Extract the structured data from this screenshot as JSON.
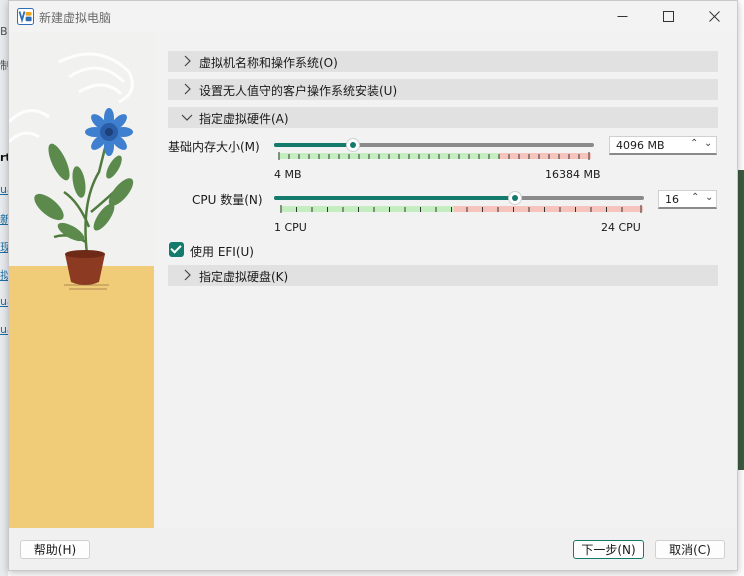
{
  "window": {
    "title": "新建虚拟电脑"
  },
  "titlebar": {
    "minimize_icon": "minimize-icon",
    "maximize_icon": "maximize-icon",
    "close_icon": "close-icon"
  },
  "sections": [
    {
      "label": "虚拟机名称和操作系统(O)",
      "expanded": false
    },
    {
      "label": "设置无人值守的客户操作系统安装(U)",
      "expanded": false
    },
    {
      "label": "指定虚拟硬件(A)",
      "expanded": true
    },
    {
      "label": "指定虚拟硬盘(K)",
      "expanded": false
    }
  ],
  "hardware": {
    "memory": {
      "label": "基础内存大小(M)",
      "value": "4096 MB",
      "min_label": "4 MB",
      "max_label": "16384 MB",
      "level": 0.25
    },
    "cpu": {
      "label": "CPU 数量(N)",
      "value": "16",
      "min_label": "1 CPU",
      "max_label": "24 CPU",
      "level": 0.652
    },
    "efi": {
      "label": "使用 EFI(U)",
      "checked": true
    }
  },
  "footer": {
    "help": "帮助(H)",
    "next": "下一步(N)",
    "cancel": "取消(C)"
  },
  "colors": {
    "accent": "#137a6c",
    "tick_green": "#c4eec0",
    "tick_red": "#f7c3bd",
    "art_ground": "#f1cc78"
  },
  "background": {
    "fragments": [
      "Bo",
      "制",
      "rt",
      "ua",
      "新",
      "现",
      "拟",
      "ua",
      "ua"
    ]
  }
}
